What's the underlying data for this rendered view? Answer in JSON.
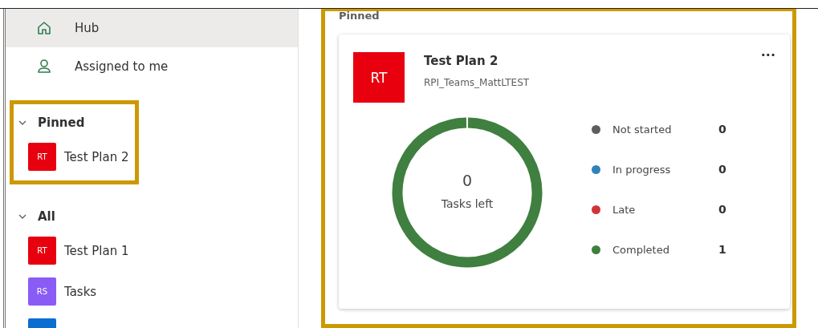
{
  "sidebar": {
    "nav": [
      {
        "label": "Hub",
        "selected": true
      },
      {
        "label": "Assigned to me",
        "selected": false
      }
    ],
    "groups": [
      {
        "title": "Pinned",
        "expanded": true,
        "highlighted": true,
        "plans": [
          {
            "initials": "RT",
            "name": "Test Plan 2",
            "color": "#e8000f"
          }
        ]
      },
      {
        "title": "All",
        "expanded": true,
        "highlighted": false,
        "plans": [
          {
            "initials": "RT",
            "name": "Test Plan 1",
            "color": "#e8000f"
          },
          {
            "initials": "RS",
            "name": "Tasks",
            "color": "#8a5cf6"
          },
          {
            "color": "#0a6ed1"
          }
        ]
      }
    ]
  },
  "main": {
    "section_title": "Pinned",
    "highlighted": true,
    "card": {
      "initials": "RT",
      "color": "#e8000f",
      "title": "Test Plan 2",
      "subtitle": "RPI_Teams_MattLTEST",
      "more": "···",
      "center_count": "0",
      "center_label": "Tasks left",
      "legend": [
        {
          "label": "Not started",
          "count": "0",
          "color": "#605e5c"
        },
        {
          "label": "In progress",
          "count": "0",
          "color": "#2f83b8"
        },
        {
          "label": "Late",
          "count": "0",
          "color": "#d13438"
        },
        {
          "label": "Completed",
          "count": "1",
          "color": "#3f7f3f"
        }
      ]
    }
  }
}
